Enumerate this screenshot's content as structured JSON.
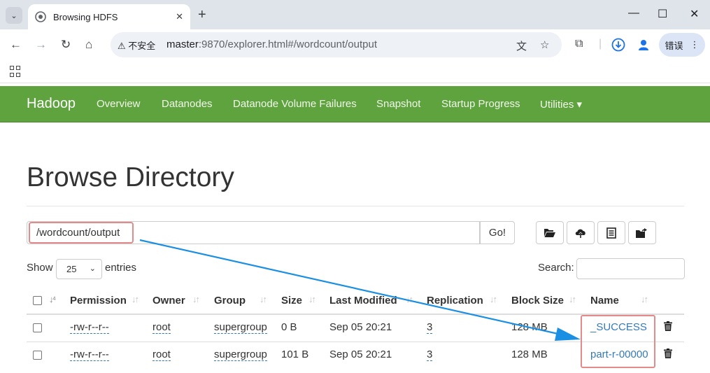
{
  "browser": {
    "tab_title": "Browsing HDFS",
    "security_label": "不安全",
    "url_host": "master",
    "url_rest": ":9870/explorer.html#/wordcount/output",
    "profile_label": "错误"
  },
  "nav": {
    "brand": "Hadoop",
    "items": [
      "Overview",
      "Datanodes",
      "Datanode Volume Failures",
      "Snapshot",
      "Startup Progress",
      "Utilities ▾"
    ]
  },
  "page": {
    "title": "Browse Directory",
    "path_value": "/wordcount/output",
    "go_label": "Go!",
    "show_label": "Show",
    "entries_value": "25",
    "entries_label": "entries",
    "search_label": "Search:"
  },
  "table": {
    "columns": [
      "Permission",
      "Owner",
      "Group",
      "Size",
      "Last Modified",
      "Replication",
      "Block Size",
      "Name"
    ],
    "rows": [
      [
        "-rw-r--r--",
        "root",
        "supergroup",
        "0 B",
        "Sep 05 20:21",
        "3",
        "128 MB",
        "_SUCCESS"
      ],
      [
        "-rw-r--r--",
        "root",
        "supergroup",
        "101 B",
        "Sep 05 20:21",
        "3",
        "128 MB",
        "part-r-00000"
      ]
    ]
  },
  "colors": {
    "navbar": "#5fa33e",
    "link": "#337ab7",
    "highlight": "#e48a8a",
    "arrow": "#1a8fe3"
  }
}
